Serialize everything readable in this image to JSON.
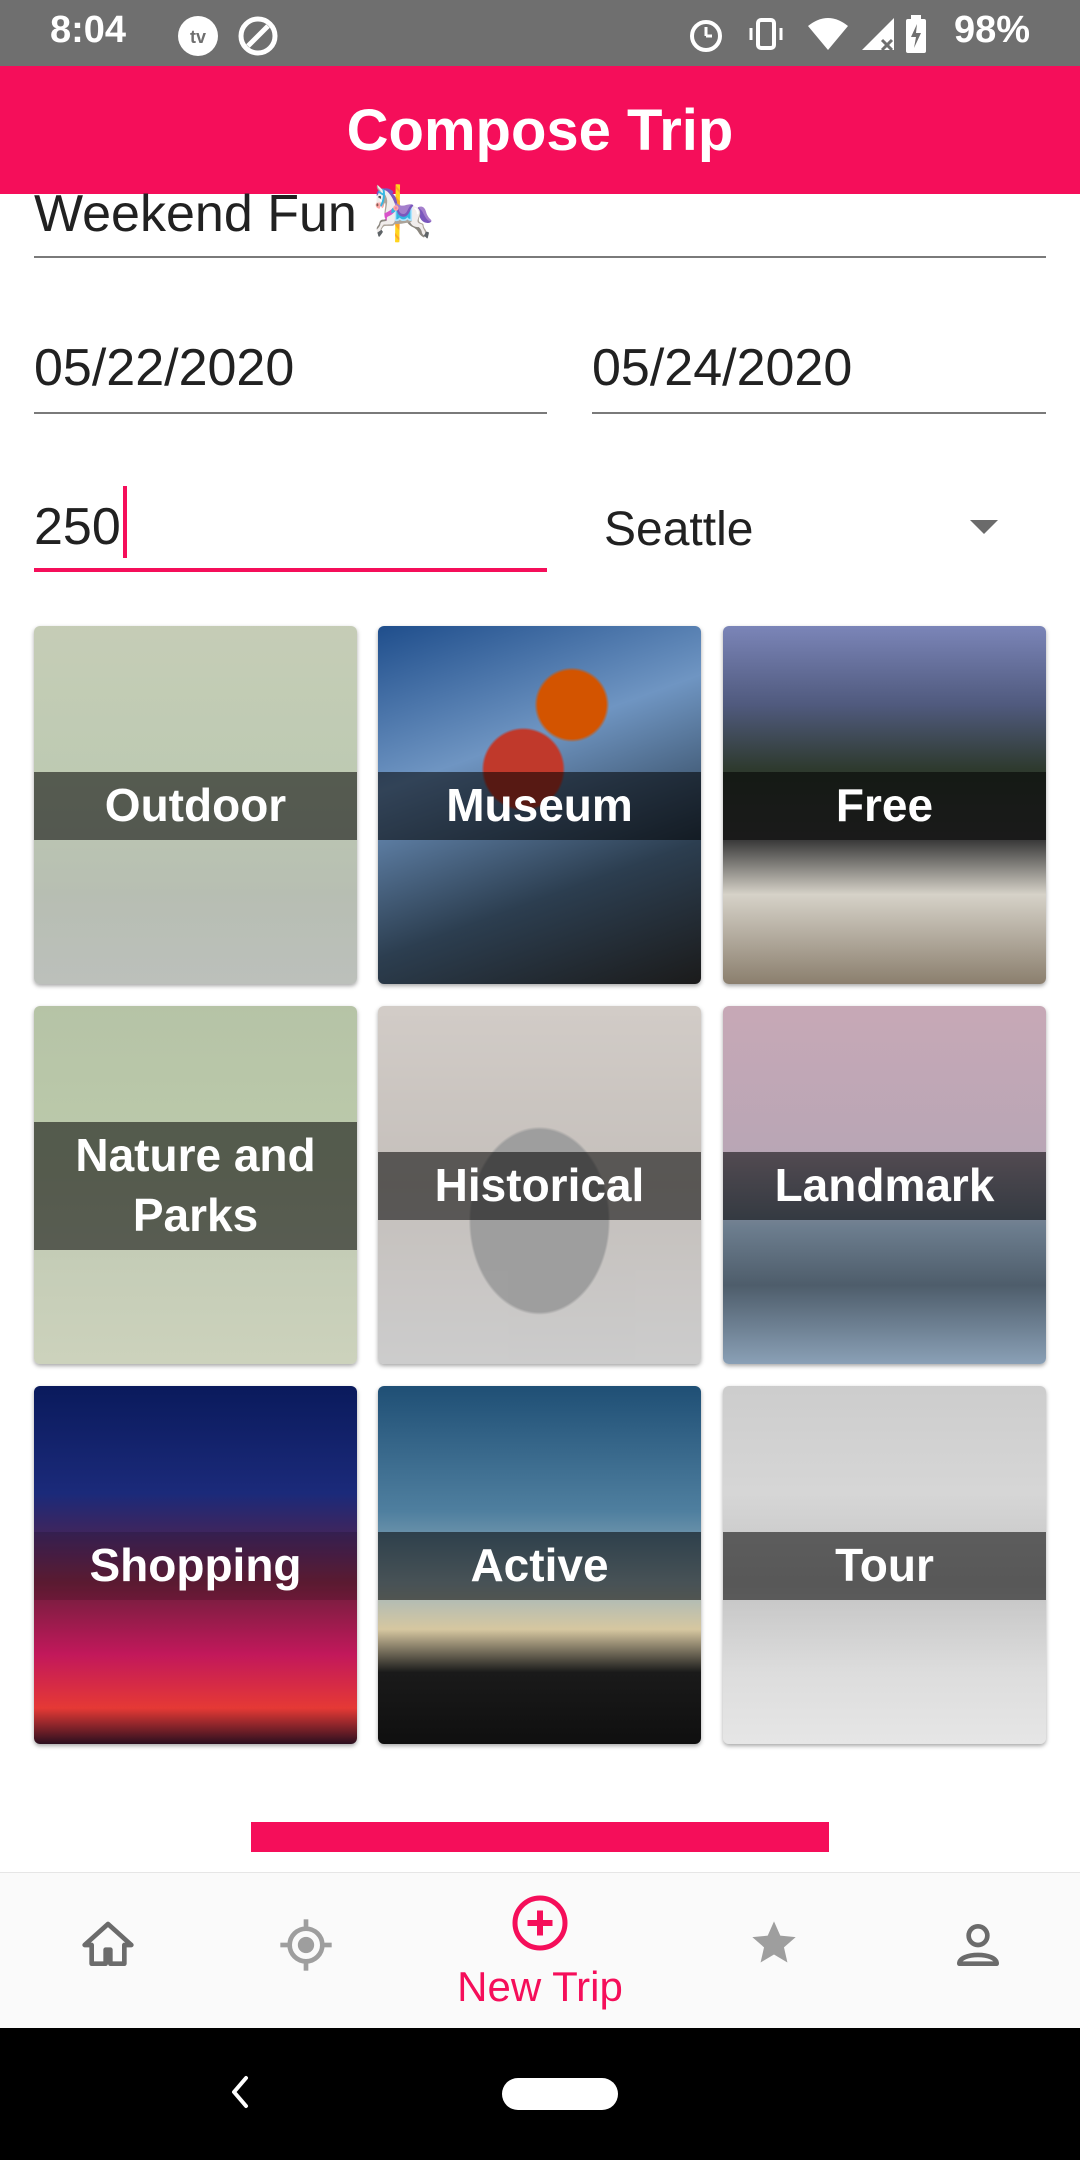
{
  "status_bar": {
    "time": "8:04",
    "battery": "98%"
  },
  "app_bar": {
    "title": "Compose Trip"
  },
  "form": {
    "trip_name": "Weekend Fun 🎠",
    "start_date": "05/22/2020",
    "end_date": "05/24/2020",
    "budget": "250",
    "city": "Seattle"
  },
  "categories": [
    {
      "label": "Outdoor",
      "selected": false
    },
    {
      "label": "Museum",
      "selected": true
    },
    {
      "label": "Free",
      "selected": true
    },
    {
      "label": "Nature and Parks",
      "selected": false
    },
    {
      "label": "Historical",
      "selected": false
    },
    {
      "label": "Landmark",
      "selected": true
    },
    {
      "label": "Shopping",
      "selected": true
    },
    {
      "label": "Active",
      "selected": true
    },
    {
      "label": "Tour",
      "selected": false
    }
  ],
  "bottom_nav": {
    "items": [
      {
        "icon": "home-icon"
      },
      {
        "icon": "location-icon"
      },
      {
        "icon": "add-circle-icon",
        "label": "New Trip",
        "active": true
      },
      {
        "icon": "star-icon"
      },
      {
        "icon": "person-icon"
      }
    ]
  },
  "colors": {
    "accent": "#f50e5a",
    "status_bar": "#6f6f6f"
  }
}
